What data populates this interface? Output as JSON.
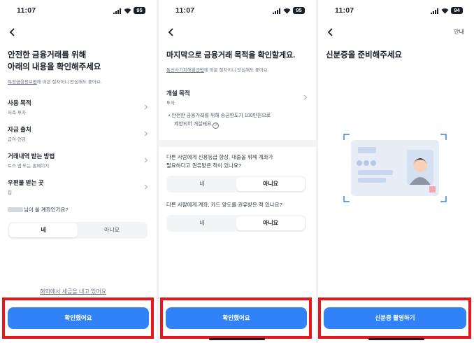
{
  "status": {
    "time": "11:07"
  },
  "screen1": {
    "battery": "95",
    "title_line1": "안전한 금융거래를 위해",
    "title_line2": "아래의 내용을 확인해주세요",
    "sub_link": "특정금융정보법",
    "sub_rest": "에 따른 절차이니 안심해도 좋아요.",
    "rows": [
      {
        "label": "사용 목적",
        "value": "저축·투자"
      },
      {
        "label": "자금 출처",
        "value": "급여·연금"
      },
      {
        "label": "거래내역 받는 방법",
        "value": "토스 앱 또는 홈페이지"
      },
      {
        "label": "우편물 받는 곳",
        "value": "집"
      }
    ],
    "question": "님이 쓸 계좌인가요?",
    "options": [
      "네",
      "아니요"
    ],
    "selected_option": "네",
    "overseas_link": "해외에서 세금을 내고 있어요",
    "cta": "확인했어요"
  },
  "screen2": {
    "battery": "95",
    "title": "마지막으로 금융거래 목적을 확인할게요.",
    "sub_link": "통신사기피해환급법",
    "sub_rest": "에 따른 절차이니 안심해도 좋아요.",
    "purpose_label": "개설 목적",
    "purpose_value": "투자",
    "note_line1": "안전한 금융거래를 위해 송금한도가 100만원으로",
    "note_line2": "제한되어 개설돼요",
    "q1_line1": "다른 사람에게 신용등급 향상, 대출을 위해 계좌가",
    "q1_line2": "필요하다고 권유받은 적이 있나요?",
    "q1_options": [
      "네",
      "아니요"
    ],
    "q2": "다른 사람에게 계좌, 카드 양도를 권유받은 적 있나요?",
    "q2_options": [
      "네",
      "아니요"
    ],
    "cta": "확인했어요"
  },
  "screen3": {
    "battery": "94",
    "guide": "안내",
    "title": "신분증을 준비해주세요",
    "cta": "신분증 촬영하기"
  },
  "colors": {
    "primary": "#3182f6",
    "highlight": "#e8151b",
    "text": "#191f28",
    "muted": "#6b7684"
  }
}
